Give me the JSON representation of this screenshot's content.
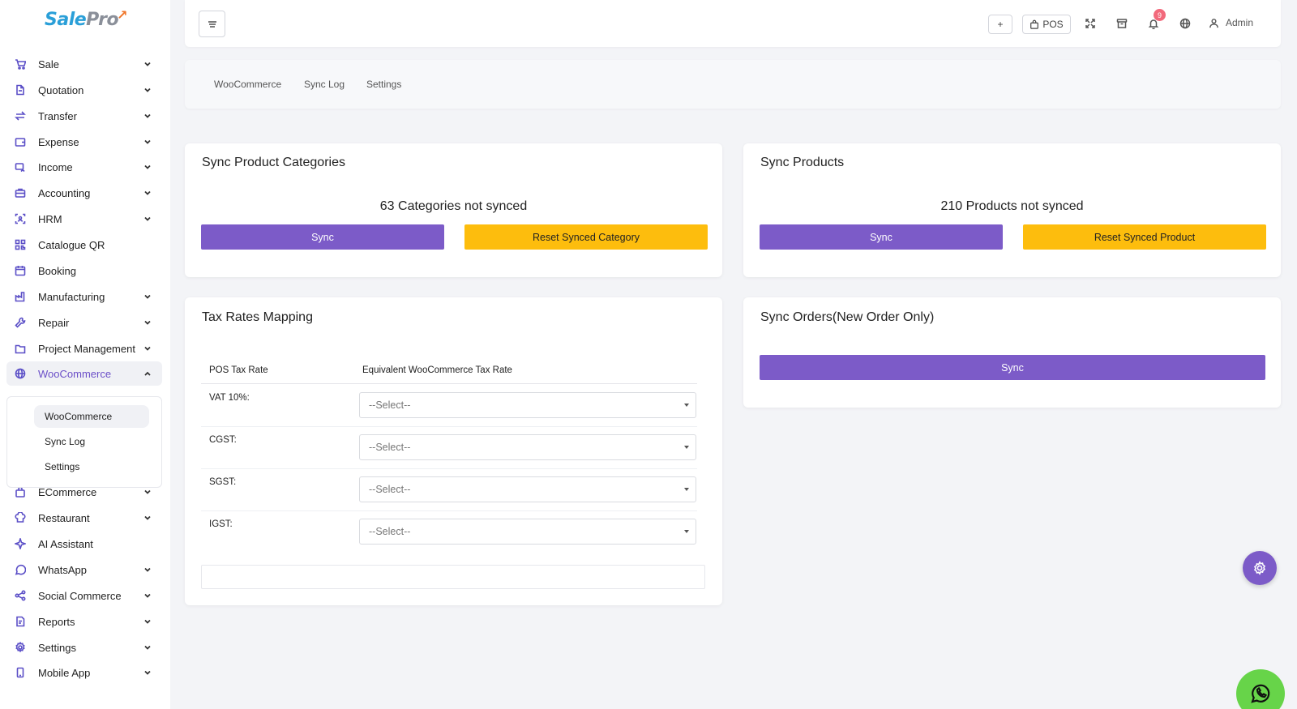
{
  "app": {
    "logo_main": "Sale",
    "logo_accent": "Pro"
  },
  "sidebar": {
    "items": [
      {
        "label": "Sale",
        "icon": "cart-icon",
        "has_chevron": true
      },
      {
        "label": "Quotation",
        "icon": "document-icon",
        "has_chevron": true
      },
      {
        "label": "Transfer",
        "icon": "transfer-icon",
        "has_chevron": true
      },
      {
        "label": "Expense",
        "icon": "wallet-icon",
        "has_chevron": true
      },
      {
        "label": "Income",
        "icon": "income-icon",
        "has_chevron": true
      },
      {
        "label": "Accounting",
        "icon": "briefcase-icon",
        "has_chevron": true
      },
      {
        "label": "HRM",
        "icon": "user-scan-icon",
        "has_chevron": true
      },
      {
        "label": "Catalogue QR",
        "icon": "qr-icon",
        "has_chevron": false
      },
      {
        "label": "Booking",
        "icon": "calendar-icon",
        "has_chevron": false
      },
      {
        "label": "Manufacturing",
        "icon": "factory-icon",
        "has_chevron": true
      },
      {
        "label": "Repair",
        "icon": "wrench-icon",
        "has_chevron": true
      },
      {
        "label": "Project Management",
        "icon": "folder-icon",
        "has_chevron": true
      },
      {
        "label": "WooCommerce",
        "icon": "globe-icon",
        "has_chevron": true,
        "expanded": true
      },
      {
        "label": "ECommerce",
        "icon": "bag-icon",
        "has_chevron": true
      },
      {
        "label": "Restaurant",
        "icon": "chef-icon",
        "has_chevron": true
      },
      {
        "label": "AI Assistant",
        "icon": "sparkle-icon",
        "has_chevron": false
      },
      {
        "label": "WhatsApp",
        "icon": "whatsapp-icon",
        "has_chevron": true
      },
      {
        "label": "Social Commerce",
        "icon": "share-icon",
        "has_chevron": true
      },
      {
        "label": "Reports",
        "icon": "report-icon",
        "has_chevron": true
      },
      {
        "label": "Settings",
        "icon": "gear-icon",
        "has_chevron": true
      },
      {
        "label": "Mobile App",
        "icon": "mobile-icon",
        "has_chevron": true
      }
    ],
    "submenu": [
      {
        "label": "WooCommerce",
        "active": true
      },
      {
        "label": "Sync Log",
        "active": false
      },
      {
        "label": "Settings",
        "active": false
      }
    ]
  },
  "topbar": {
    "add_label": "+",
    "pos_label": "POS",
    "notification_count": "9",
    "user_label": "Admin"
  },
  "tabs": [
    "WooCommerce",
    "Sync Log",
    "Settings"
  ],
  "categories_card": {
    "title": "Sync Product Categories",
    "status": "63 Categories not synced",
    "sync_label": "Sync",
    "reset_label": "Reset Synced Category"
  },
  "products_card": {
    "title": "Sync Products",
    "status": "210 Products not synced",
    "sync_label": "Sync",
    "reset_label": "Reset Synced Product"
  },
  "tax_card": {
    "title": "Tax Rates Mapping",
    "col_pos": "POS Tax Rate",
    "col_woo": "Equivalent WooCommerce Tax Rate",
    "rows": [
      {
        "label": "VAT 10%:",
        "selected": "--Select--"
      },
      {
        "label": "CGST:",
        "selected": "--Select--"
      },
      {
        "label": "SGST:",
        "selected": "--Select--"
      },
      {
        "label": "IGST:",
        "selected": "--Select--"
      }
    ]
  },
  "orders_card": {
    "title": "Sync Orders(New Order Only)",
    "sync_label": "Sync"
  },
  "colors": {
    "accent": "#7c5bc8",
    "warning": "#fdbd0d",
    "logo_blue": "#2a9fd8",
    "badge": "#f26a7c",
    "whatsapp": "#67d449"
  }
}
